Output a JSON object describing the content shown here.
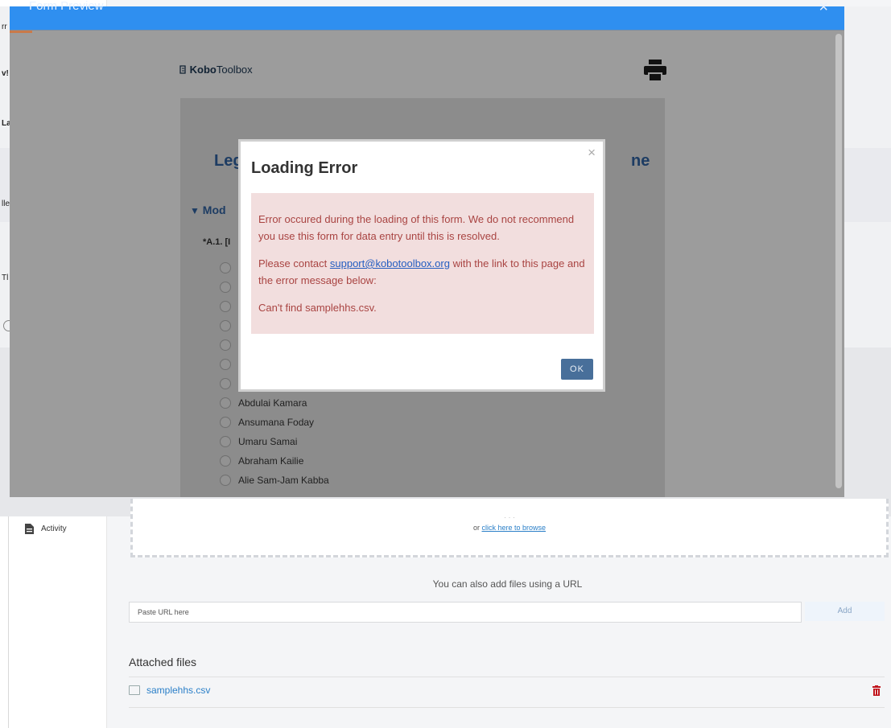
{
  "background": {
    "sidebar": {
      "activity_label": "Activity"
    },
    "row_fragments": [
      "rr",
      "v!",
      "La",
      "lle",
      "Tl"
    ],
    "dropzone": {
      "browse_prefix": "or",
      "browse_link": "click here to browse"
    },
    "url": {
      "label": "You can also add files using a URL",
      "placeholder": "Paste URL here",
      "add_label": "Add"
    },
    "attached": {
      "title": "Attached files",
      "files": [
        "samplehhs.csv"
      ]
    }
  },
  "form_preview": {
    "title": "Form Preview",
    "close_glyph": "×",
    "logo": {
      "bold": "Kobo",
      "light": "Toolbox"
    },
    "form_title_left": "Leg",
    "form_title_right": "ne",
    "module_label": "Mod",
    "question_label": "*A.1. [I",
    "options": [
      "Abdulai Kamara",
      "Ansumana Foday",
      "Umaru Samai",
      "Abraham Kailie",
      "Alie Sam-Jam Kabba"
    ]
  },
  "error_dialog": {
    "title": "Loading Error",
    "close_glyph": "×",
    "paragraph1": "Error occured during the loading of this form. We do not recommend you use this form for data entry until this is resolved.",
    "paragraph2_before": "Please contact ",
    "email": "support@kobotoolbox.org",
    "paragraph2_after": " with the link to this page and the error message below:",
    "paragraph3": "Can't find samplehhs.csv.",
    "ok_label": "OK"
  },
  "colors": {
    "header_blue": "#2f8ff0",
    "error_text": "#a94442",
    "error_bg": "#f2dede",
    "ok_button": "#486f9a",
    "link": "#2a7fc8"
  }
}
